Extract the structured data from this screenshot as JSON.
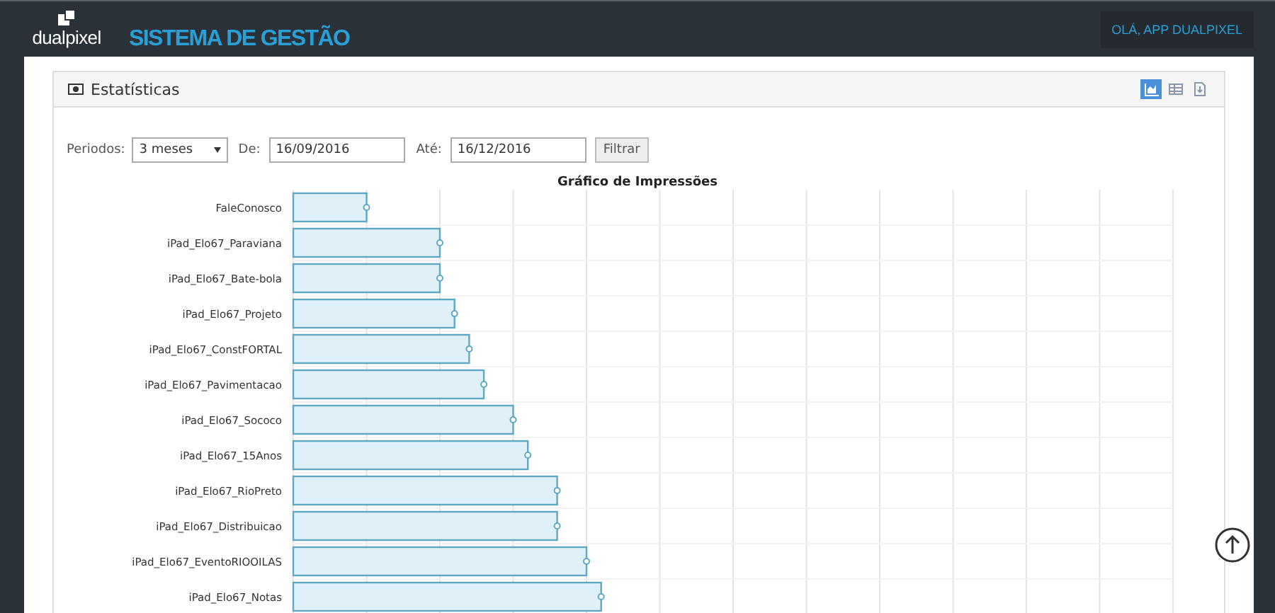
{
  "header": {
    "logo": "dualpixel",
    "title": "SISTEMA DE GESTÃO",
    "user_button": "OLÁ, APP DUALPIXEL"
  },
  "panel": {
    "title": "Estatísticas",
    "view_buttons": [
      {
        "kind": "chart",
        "selected": true
      },
      {
        "kind": "table",
        "selected": false
      },
      {
        "kind": "export",
        "selected": false
      }
    ]
  },
  "filters": {
    "period_label": "Periodos:",
    "period_value": "3 meses",
    "from_label": "De:",
    "from_value": "16/09/2016",
    "to_label": "Até:",
    "to_value": "16/12/2016",
    "filter_button": "Filtrar"
  },
  "chart": {
    "title": "Gráfico de Impressões",
    "bars": [
      {
        "label": "FaleConosco"
      },
      {
        "label": "iPad_Elo67_Paraviana"
      },
      {
        "label": "iPad_Elo67_Bate-bola"
      },
      {
        "label": "iPad_Elo67_Projeto"
      },
      {
        "label": "iPad_Elo67_ConstFORTAL"
      },
      {
        "label": "iPad_Elo67_Pavimentacao"
      },
      {
        "label": "iPad_Elo67_Sococo"
      },
      {
        "label": "iPad_Elo67_15Anos"
      },
      {
        "label": "iPad_Elo67_RioPreto"
      },
      {
        "label": "iPad_Elo67_Distribuicao"
      },
      {
        "label": "iPad_Elo67_EventoRIOOILAS"
      },
      {
        "label": "iPad_Elo67_Notas"
      }
    ]
  }
}
